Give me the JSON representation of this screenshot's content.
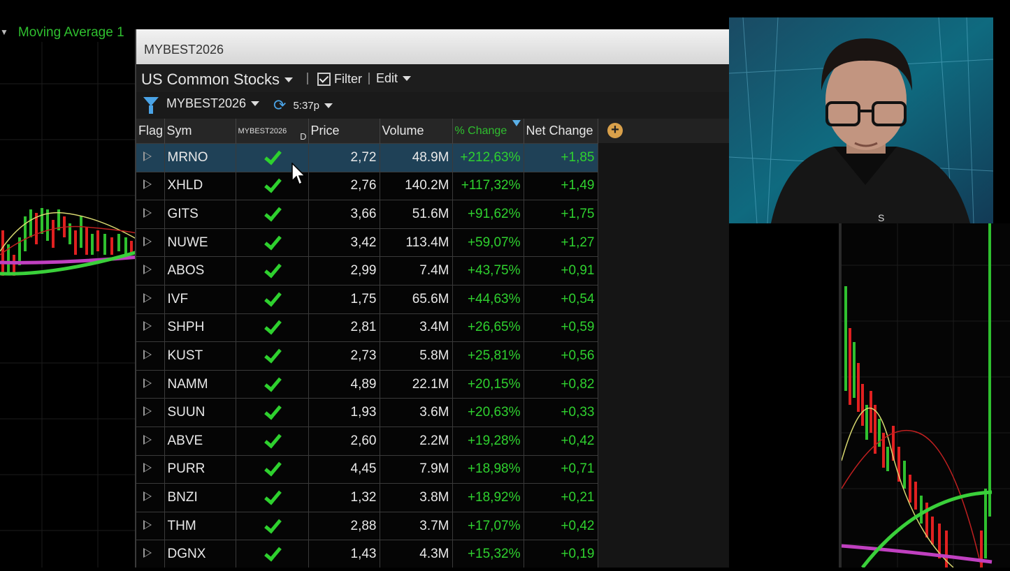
{
  "background": {
    "indicator_label": "Moving Average 1"
  },
  "scanner": {
    "title": "MYBEST2026",
    "universe": "US Common Stocks",
    "filter_label": "Filter",
    "edit_label": "Edit",
    "scan_name": "MYBEST2026",
    "refresh_time": "5:37p",
    "columns": {
      "flag": "Flag",
      "sym": "Sym",
      "scan": "MYBEST2026",
      "scan_suffix": "D",
      "price": "Price",
      "volume": "Volume",
      "pct_change": "% Change",
      "net_change": "Net Change"
    },
    "add_column_symbol": "+",
    "rows": [
      {
        "sym": "MRNO",
        "price": "2,72",
        "volume": "48.9M",
        "pct": "+212,63%",
        "net": "+1,85"
      },
      {
        "sym": "XHLD",
        "price": "2,76",
        "volume": "140.2M",
        "pct": "+117,32%",
        "net": "+1,49"
      },
      {
        "sym": "GITS",
        "price": "3,66",
        "volume": "51.6M",
        "pct": "+91,62%",
        "net": "+1,75"
      },
      {
        "sym": "NUWE",
        "price": "3,42",
        "volume": "113.4M",
        "pct": "+59,07%",
        "net": "+1,27"
      },
      {
        "sym": "ABOS",
        "price": "2,99",
        "volume": "7.4M",
        "pct": "+43,75%",
        "net": "+0,91"
      },
      {
        "sym": "IVF",
        "price": "1,75",
        "volume": "65.6M",
        "pct": "+44,63%",
        "net": "+0,54"
      },
      {
        "sym": "SHPH",
        "price": "2,81",
        "volume": "3.4M",
        "pct": "+26,65%",
        "net": "+0,59"
      },
      {
        "sym": "KUST",
        "price": "2,73",
        "volume": "5.8M",
        "pct": "+25,81%",
        "net": "+0,56"
      },
      {
        "sym": "NAMM",
        "price": "4,89",
        "volume": "22.1M",
        "pct": "+20,15%",
        "net": "+0,82"
      },
      {
        "sym": "SUUN",
        "price": "1,93",
        "volume": "3.6M",
        "pct": "+20,63%",
        "net": "+0,33"
      },
      {
        "sym": "ABVE",
        "price": "2,60",
        "volume": "2.2M",
        "pct": "+19,28%",
        "net": "+0,42"
      },
      {
        "sym": "PURR",
        "price": "4,45",
        "volume": "7.9M",
        "pct": "+18,98%",
        "net": "+0,71"
      },
      {
        "sym": "BNZI",
        "price": "1,32",
        "volume": "3.8M",
        "pct": "+18,92%",
        "net": "+0,21"
      },
      {
        "sym": "THM",
        "price": "2,88",
        "volume": "3.7M",
        "pct": "+17,07%",
        "net": "+0,42"
      },
      {
        "sym": "DGNX",
        "price": "1,43",
        "volume": "4.3M",
        "pct": "+15,32%",
        "net": "+0,19"
      }
    ]
  },
  "colors": {
    "positive": "#2fd12f",
    "selected_row": "#1f4157",
    "sort_indicator": "#5ab0e8"
  }
}
